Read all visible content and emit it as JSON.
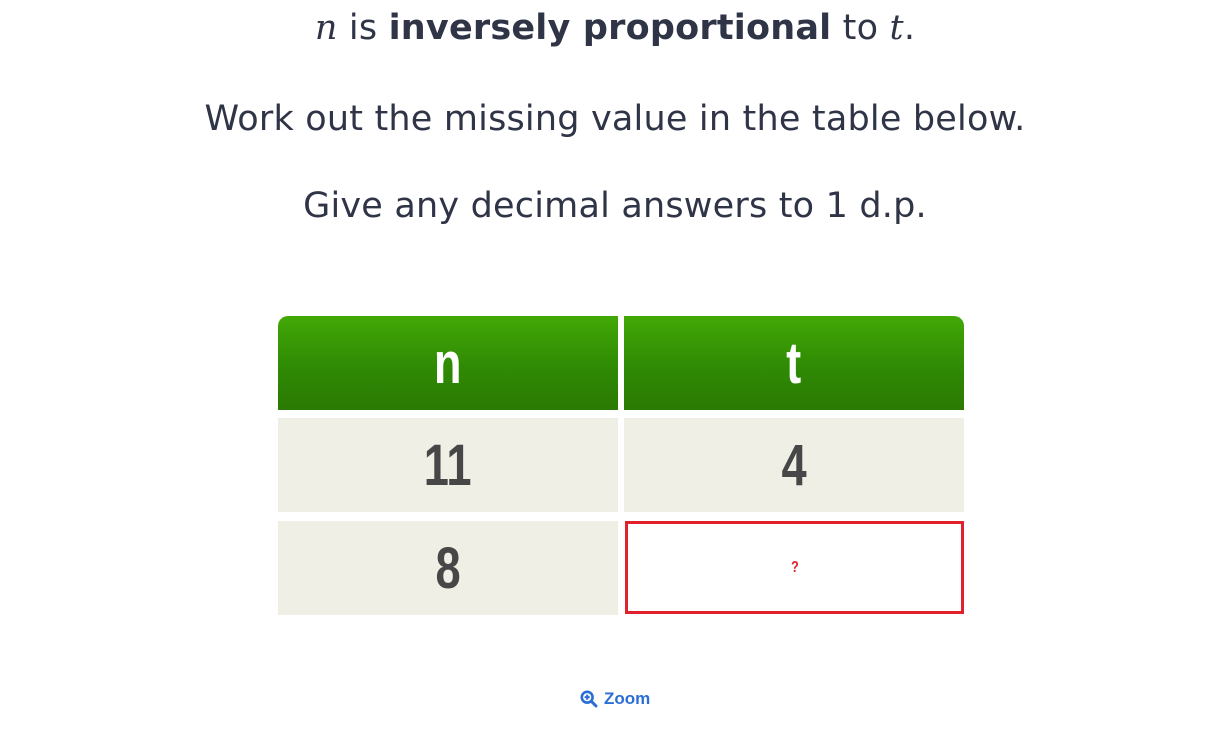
{
  "question": {
    "line1": {
      "var_n": "n",
      "text_is": " is ",
      "bold_phrase": "inversely proportional",
      "text_to": " to ",
      "var_t": "t",
      "period": "."
    },
    "line2": "Work out the missing value in the table below.",
    "line3": "Give any decimal answers to 1 d.p."
  },
  "table": {
    "headers": [
      "n",
      "t"
    ],
    "rows": [
      [
        "11",
        "4"
      ],
      [
        "8",
        "?"
      ]
    ]
  },
  "zoom": {
    "label": "Zoom",
    "icon": "zoom-in-icon"
  },
  "colors": {
    "header_green": "#3a9a05",
    "cell_bg": "#f0efe6",
    "missing_red": "#e0202a",
    "link_blue": "#2b6fd6",
    "text": "#2f3447"
  }
}
